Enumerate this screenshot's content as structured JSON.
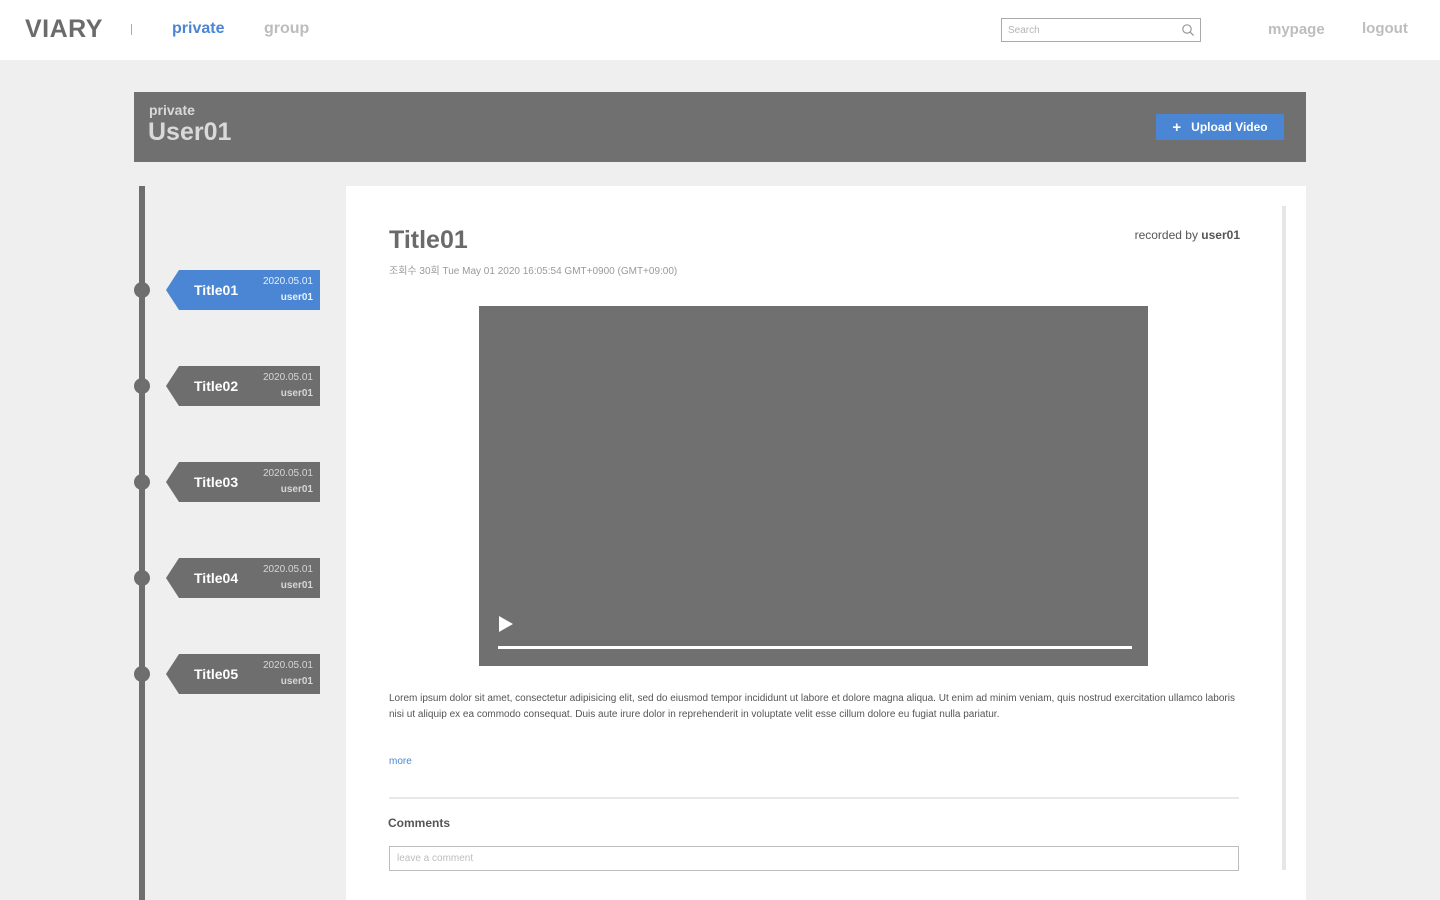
{
  "nav": {
    "logo": "VIARY",
    "separator": "|",
    "private_label": "private",
    "group_label": "group",
    "search_placeholder": "Search",
    "search_icon": "search-icon",
    "mypage_label": "mypage",
    "logout_label": "logout",
    "active_color": "#4a86d4"
  },
  "header": {
    "section_label": "private",
    "user_name": "User01",
    "upload_icon": "plus-icon",
    "upload_symbol": "+",
    "upload_label": "Upload Video"
  },
  "timeline": {
    "items": [
      {
        "title": "Title01",
        "date": "2020.05.01",
        "user": "user01",
        "active": true
      },
      {
        "title": "Title02",
        "date": "2020.05.01",
        "user": "user01",
        "active": false
      },
      {
        "title": "Title03",
        "date": "2020.05.01",
        "user": "user01",
        "active": false
      },
      {
        "title": "Title04",
        "date": "2020.05.01",
        "user": "user01",
        "active": false
      },
      {
        "title": "Title05",
        "date": "2020.05.01",
        "user": "user01",
        "active": false
      }
    ]
  },
  "post": {
    "title": "Title01",
    "recorded_prefix": "recorded by",
    "recorded_user": "user01",
    "meta": "조회수 30회 Tue May 01 2020 16:05:54 GMT+0900 (GMT+09:00)",
    "play_icon": "play-icon",
    "description": "Lorem ipsum dolor sit amet, consectetur adipisicing elit, sed do eiusmod tempor incididunt ut labore et dolore magna aliqua. Ut enim ad minim veniam, quis nostrud exercitation ullamco laboris nisi ut aliquip ex ea commodo consequat. Duis aute irure dolor in reprehenderit in voluptate velit esse cillum dolore eu fugiat nulla pariatur.",
    "more_label": "more"
  },
  "comments": {
    "heading": "Comments",
    "placeholder": "leave a comment"
  }
}
